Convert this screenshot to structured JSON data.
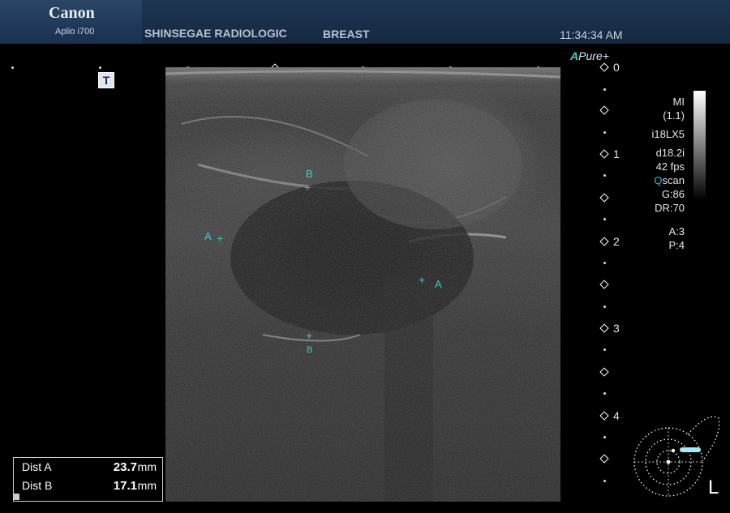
{
  "header": {
    "brand": "Canon",
    "model": "Aplio i700",
    "hospital": "SHINSEGAE RADIOLOGIC",
    "exam": "BREAST",
    "time": "11:34:34 AM"
  },
  "markers": {
    "t_marker": "T",
    "apure_a": "A",
    "apure_text": "Pure+"
  },
  "depth_scale": [
    "0",
    "1",
    "2",
    "3",
    "4"
  ],
  "params": {
    "mi_label": "MI",
    "mi_value": "(1.1)",
    "probe": "i18LX5",
    "depth_gain": "d18.2i",
    "fps": "42 fps",
    "qscan_q": "Q",
    "qscan_rest": "scan",
    "gain": "G:86",
    "dr": "DR:70",
    "a": "A:3",
    "p": "P:4"
  },
  "calipers": {
    "a_label": "A",
    "b_label": "B",
    "cross": "+"
  },
  "measurements": [
    {
      "label": "Dist A",
      "value": "23.7",
      "unit": "mm"
    },
    {
      "label": "Dist B",
      "value": "17.1",
      "unit": "mm"
    }
  ],
  "side": "L",
  "colors": {
    "caliper": "#3fc9cc",
    "header_bg": "#1e3552",
    "qscan_accent": "#39b6e0"
  }
}
